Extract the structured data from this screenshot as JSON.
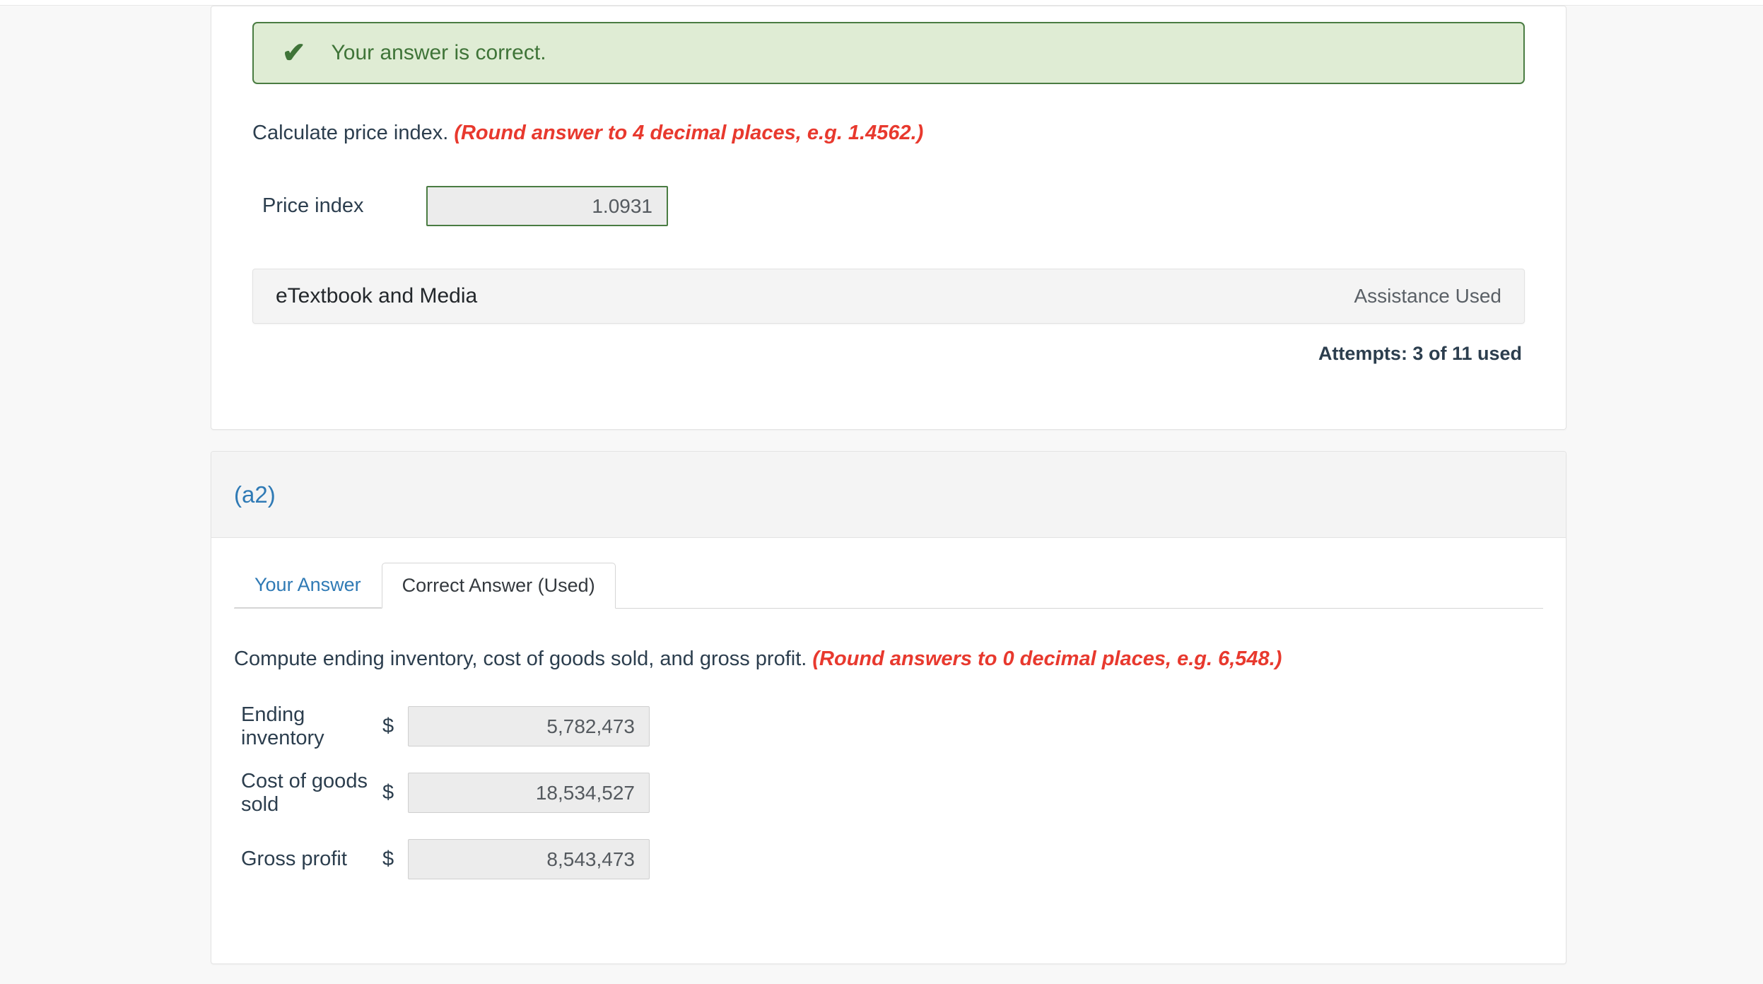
{
  "colors": {
    "success_border": "#4a7c42",
    "success_bg": "#dfecd4",
    "success_text": "#3f7438",
    "hint_red": "#e8392e",
    "link_blue": "#2f7ab5",
    "body_text": "#2c3e4e"
  },
  "part_a1": {
    "status_banner": {
      "icon": "check-icon",
      "message": "Your answer is correct."
    },
    "question": {
      "prompt": "Calculate price index.",
      "hint": "(Round answer to 4 decimal places, e.g. 1.4562.)"
    },
    "answer": {
      "label": "Price index",
      "value": "1.0931"
    },
    "etextbook": {
      "label": "eTextbook and Media",
      "assistance": "Assistance Used"
    },
    "attempts": "Attempts: 3 of 11 used"
  },
  "part_a2": {
    "header_title": "(a2)",
    "tabs": [
      {
        "label": "Your Answer",
        "active": false
      },
      {
        "label": "Correct Answer (Used)",
        "active": true
      }
    ],
    "question": {
      "prompt": "Compute ending inventory, cost of goods sold, and gross profit.",
      "hint": "(Round answers to 0 decimal places, e.g. 6,548.)"
    },
    "rows": [
      {
        "label": "Ending inventory",
        "currency": "$",
        "value": "5,782,473"
      },
      {
        "label": "Cost of goods sold",
        "currency": "$",
        "value": "18,534,527"
      },
      {
        "label": "Gross profit",
        "currency": "$",
        "value": "8,543,473"
      }
    ]
  }
}
